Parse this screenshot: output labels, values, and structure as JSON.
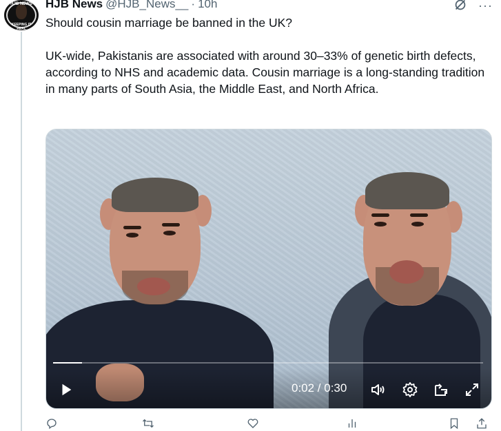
{
  "author": {
    "display_name": "HJB News",
    "handle": "@HJB_News__",
    "separator": "·",
    "timestamp": "10h",
    "avatar_top_text": "HJB NEWS",
    "avatar_bottom_text": "KEEPING IT REAL"
  },
  "tweet": {
    "question": "Should cousin marriage be banned in the UK?",
    "body": "UK-wide, Pakistanis are associated with around 30–33% of genetic birth defects, according to NHS and academic data. Cousin marriage is a long-standing tradition in many parts of South Asia, the Middle East, and North Africa."
  },
  "video": {
    "current_time": "0:02",
    "duration": "0:30",
    "time_label": "0:02 / 0:30",
    "progress_fraction": 0.067
  },
  "icons": {
    "grok": "grok-icon",
    "more": "more-icon",
    "play": "play-icon",
    "volume": "volume-icon",
    "settings": "settings-icon",
    "popout": "popout-icon",
    "fullscreen": "fullscreen-icon",
    "reply": "reply-icon",
    "retweet": "retweet-icon",
    "like": "like-icon",
    "views": "views-icon",
    "bookmark": "bookmark-icon",
    "share": "share-icon"
  },
  "colors": {
    "text_primary": "#0f1419",
    "text_secondary": "#536471",
    "border": "#cfd9de"
  }
}
